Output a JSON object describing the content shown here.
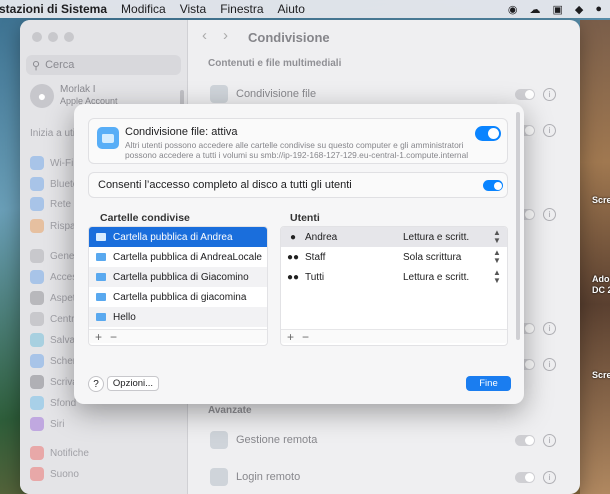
{
  "menubar": {
    "app": "stazioni di Sistema",
    "items": [
      "Modifica",
      "Vista",
      "Finestra",
      "Aiuto"
    ]
  },
  "settings": {
    "title": "Condivisione",
    "search_placeholder": "Cerca",
    "account_name": "Morlak I",
    "account_sub": "Apple Account",
    "sidebar_head": "Inizia a uti",
    "sidebar_items": [
      "Wi-Fi",
      "Blueto",
      "Rete",
      "Rispa",
      "Gener",
      "Acces",
      "Aspet",
      "Centr",
      "Salva",
      "Scher",
      "Scriva",
      "Sfond",
      "Siri",
      "Notifiche",
      "Suono"
    ],
    "section_media": "Contenuti e file multimediali",
    "row_file_sharing": "Condivisione file",
    "section_advanced": "Avanzate",
    "row_remote_mgmt": "Gestione remota",
    "row_remote_login": "Login remoto"
  },
  "desktop": {
    "labels": [
      "Scre",
      "Ado",
      "DC 2",
      "Scre"
    ]
  },
  "sheet": {
    "title": "Condivisione file: attiva",
    "description": "Altri utenti possono accedere alle cartelle condivise su questo computer e gli amministratori possono accedere a tutti i volumi su smb://ip-192-168-127-129.eu-central-1.compute.internal",
    "full_disk_label": "Consenti l’accesso completo al disco a tutti gli utenti",
    "folders_header": "Cartelle condivise",
    "users_header": "Utenti",
    "folders": [
      "Cartella pubblica di Andrea",
      "Cartella pubblica di AndreaLocale",
      "Cartella pubblica di Giacomino",
      "Cartella pubblica di giacomina",
      "Hello"
    ],
    "users": [
      {
        "name": "Andrea",
        "permission": "Lettura e scritt.",
        "icon": "person-icon"
      },
      {
        "name": "Staff",
        "permission": "Sola scrittura",
        "icon": "group-icon"
      },
      {
        "name": "Tutti",
        "permission": "Lettura e scritt.",
        "icon": "everyone-icon"
      }
    ],
    "add_symbol": "+",
    "remove_symbol": "−",
    "help_label": "?",
    "options_label": "Opzioni...",
    "done_label": "Fine",
    "file_sharing_on": true,
    "full_disk_on": true
  },
  "colors": {
    "accent": "#0a84ff",
    "selection": "#1a6edc",
    "folder": "#5aa9ef"
  }
}
